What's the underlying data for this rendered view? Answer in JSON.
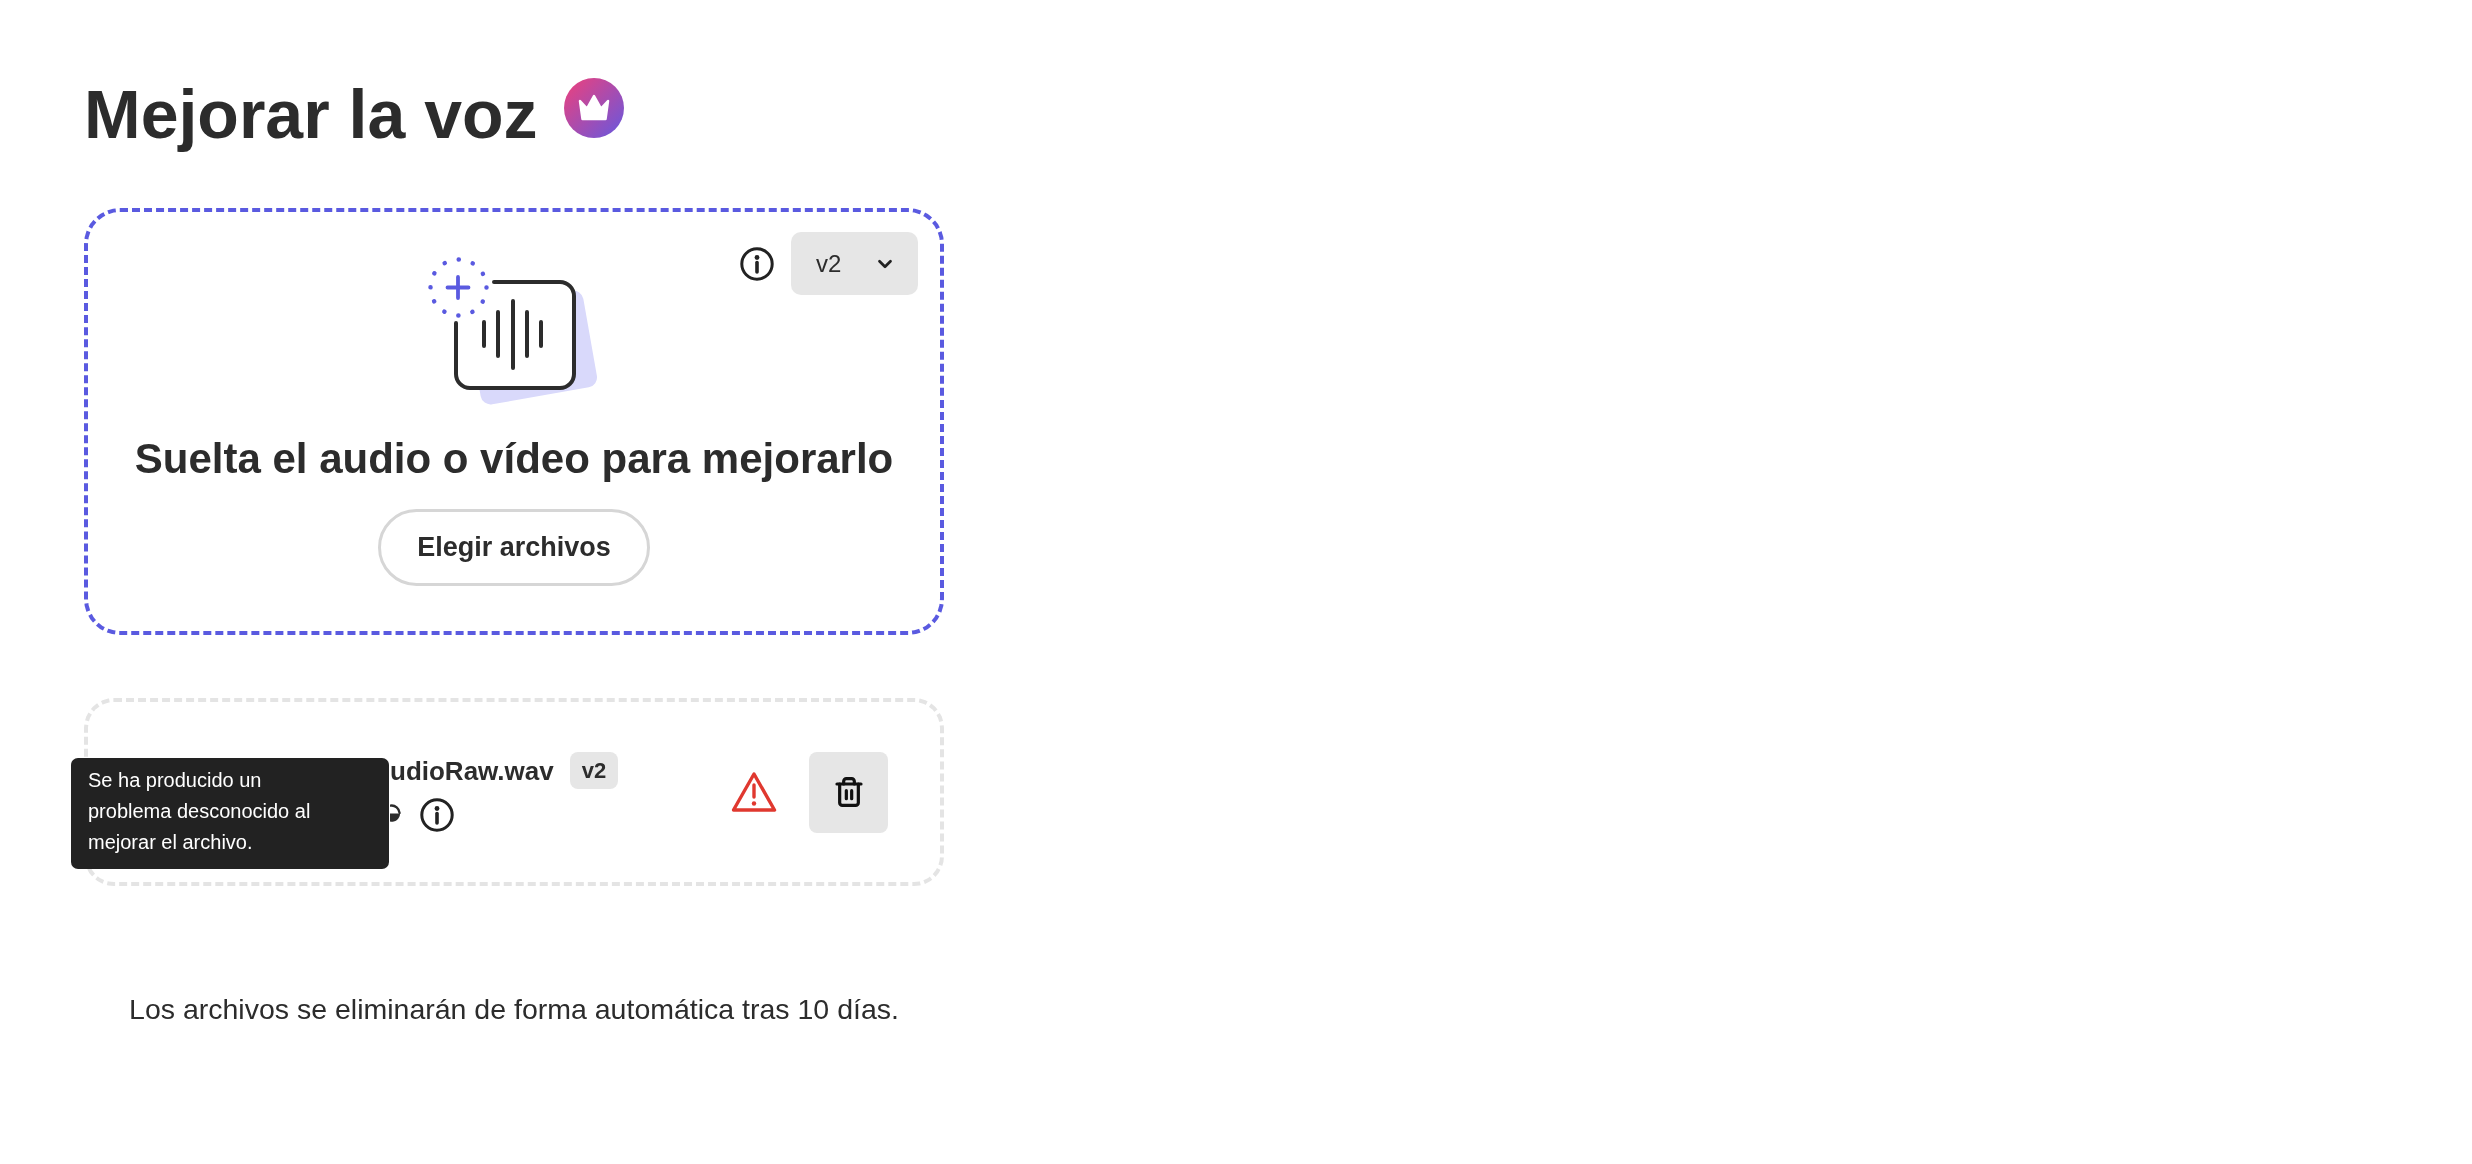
{
  "header": {
    "title": "Mejorar la voz",
    "premium": true
  },
  "drop_zone": {
    "heading": "Suelta el audio o vídeo para mejorarlo",
    "button": "Elegir archivos",
    "version_select": {
      "value": "v2"
    }
  },
  "files": [
    {
      "name": "udioRaw.wav",
      "version": "v2",
      "error": true,
      "tooltip": "Se ha producido un problema desconocido al mejorar el archivo."
    }
  ],
  "footer": {
    "note": "Los archivos se eliminarán de forma automática tras 10 días."
  }
}
